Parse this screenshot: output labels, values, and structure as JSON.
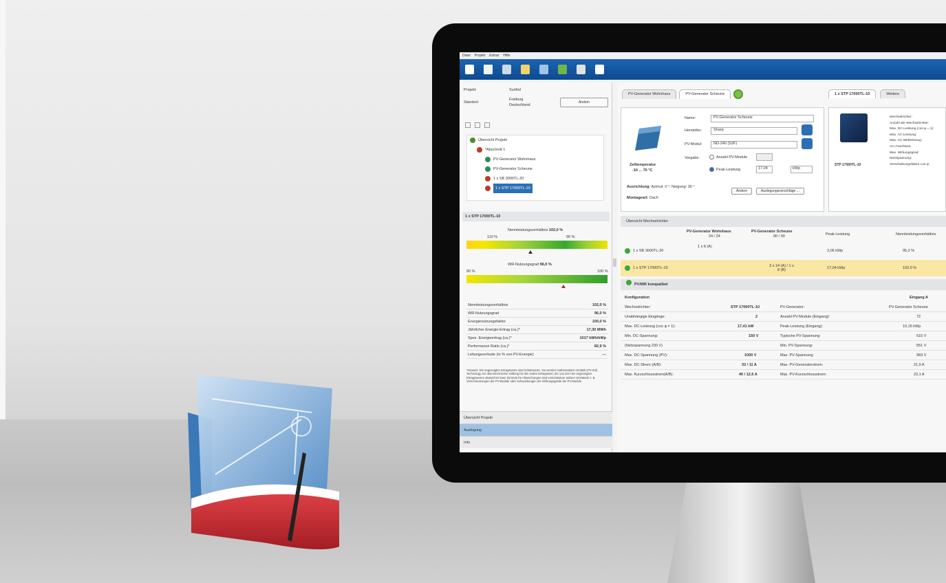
{
  "menu": [
    "Datei",
    "Projekt",
    "Extras",
    "Hilfe"
  ],
  "toolbar_icons": [
    "new-file-icon",
    "open-folder-icon",
    "save-icon",
    "home-icon",
    "report-icon",
    "tools-icon",
    "print-icon",
    "document-icon"
  ],
  "left": {
    "project_label": "Projekt:",
    "project_value": "Sunfoil",
    "location_label": "Standort:",
    "location_value_1": "Freiburg",
    "location_value_2": "Deutschland",
    "change_button": "Ändern",
    "tree": [
      "Übersicht Projekt",
      "*Abschnitt 1",
      "PV-Generator Wohnhaus",
      "PV-Generator Scheune",
      "1 x SB 3000TL-20",
      "1 x STP 17000TL-10"
    ],
    "detail_title": "1 x STP 17000TL-10",
    "ratio_label": "Nennleistungsverhältnis",
    "ratio_value": "102,0 %",
    "ratio_min": "110 %",
    "ratio_max": "90 %",
    "util_label": "WR-Nutzungsgrad",
    "util_value": "96,0 %",
    "util_min": "90 %",
    "util_max": "100 %",
    "values": [
      {
        "k": "Nennleistungsverhältnis",
        "v": "102,0 %"
      },
      {
        "k": "WR-Nutzungsgrad",
        "v": "96,0 %"
      },
      {
        "k": "Energienutzungsfaktor",
        "v": "100,0 %"
      },
      {
        "k": "Jährlicher Energie-Ertrag (ca.)*",
        "v": "17,30 MWh"
      },
      {
        "k": "Spez. Energieertrag (ca.)*",
        "v": "1017 kWh/kWp"
      },
      {
        "k": "Performance Ratio (ca.)*",
        "v": "82,9 %"
      },
      {
        "k": "Leitungsverluste (in % von PV-Energie)",
        "v": "---"
      }
    ],
    "footnote": "*Hinweis: Die angezeigten Ertragswerte sind Schätzwerte. Sie werden mathematisch ermittelt (PV-Sol) Technology AG übernimmt keine Haftung für den realen Ertragswert, der von den hier angezeigten Ertragswerten abweichen kann (Gründe für Abweichungen sind verschiedene äußere Umstände z. B. Verschmutzungen der PV-Module oder Schwankungen der Wirkungsgrade der PV-Module.",
    "accordions": [
      "Übersicht Projekt",
      "Auslegung",
      "Info"
    ]
  },
  "right": {
    "tabs": [
      "PV-Generator Wohnhaus",
      "PV-Generator Scheune"
    ],
    "inverter_tab": "1 x STP 17000TL-10",
    "inverter_tab2": "Weitere",
    "name_label": "Name:",
    "name_value": "PV-Generator Scheune",
    "manufacturer_label": "Hersteller:",
    "manufacturer_value": "Sharp",
    "module_label": "PV-Modul:",
    "module_value": "ND-240 (S2F)",
    "input_label": "Vorgabe:",
    "count_label": "Anzahl PV-Module",
    "peak_label": "Peak-Leistung",
    "peak_value": "17,04",
    "peak_unit": "kWp",
    "cell_temp_label": "Zelltemperatur",
    "cell_temp_value": "-10 ... 70 °C",
    "orientation_label": "Ausrichtung:",
    "orientation_value": "Azimut: 0 °; Neigung: 30 °",
    "mount_label": "Montageart:",
    "mount_value": "Dach",
    "change_button": "Ändern",
    "suggest_button": "Auslegungsvorschläge ...",
    "inverter_name": "STP 17000TL-10",
    "inverter_props": [
      "Wechselrichter:",
      "Anzahl der Wechselrichter:",
      "Max. DC-Leistung (cos φ = 1):",
      "Max. AC-Leistung:",
      "Max. AC-Wirkleistung:",
      "AC-Anschluss:",
      "Max. Wirkungsgrad:",
      "Netzspannung:",
      "Verschiebungsfaktor cos φ:"
    ],
    "overview_title": "Übersicht Wechselrichter",
    "ov_cols": [
      "PV-Generator Wohnhaus",
      "PV-Generator Scheune",
      "Peak-Leistung",
      "Nennleistungsverhältnis"
    ],
    "ov_sub": [
      "24 / 24",
      "90 / 90"
    ],
    "ov_rows": [
      {
        "name": "1 x SB 3000TL-20",
        "a": "1 x 8 (A)",
        "b": "",
        "peak": "3,06 kWp",
        "ratio": "95,2 %"
      },
      {
        "name": "1 x STP 17000TL-10",
        "a": "",
        "b": "3 x 14 (A) / 1 x 8 (B)",
        "peak": "17,04 kWp",
        "ratio": "102,0 %"
      }
    ],
    "compat_label": "PV/WR kompatibel",
    "config_label": "Konfiguration",
    "input_a_label": "Eingang A",
    "config": [
      {
        "k": "Wechselrichter:",
        "v": "STP 17000TL-10",
        "k2": "PV-Generator:",
        "v2": "PV-Generator Scheune"
      },
      {
        "k": "Unabhängige Eingänge:",
        "v": "2",
        "k2": "Anzahl PV-Module (Eingang):",
        "v2": "72"
      },
      {
        "k": "Max. DC-Leistung (cos φ = 1):",
        "v": "17,41 kW",
        "k2": "Peak-Leistung (Eingang):",
        "v2": "10,15 kWp"
      },
      {
        "k": "Min. DC-Spannung:",
        "v": "150 V",
        "k2": "Typische PV-Spannung:",
        "v2": "615 V"
      },
      {
        "k": "(Netzspannung 230 V)",
        "v": "",
        "k2": "Min. PV-Spannung:",
        "v2": "551 V"
      },
      {
        "k": "Max. DC-Spannung (PV):",
        "v": "1000 V",
        "k2": "Max. PV-Spannung:",
        "v2": "983 V"
      },
      {
        "k": "Max. DC-Strom (A/B):",
        "v": "33 / 11 A",
        "k2": "Max. PV-Generatorstrom:",
        "v2": "21,9 A"
      },
      {
        "k": "Max. Kurzschlussstrom(A/B):",
        "v": "40 / 12,5 A",
        "k2": "Max. PV-Kurzschlussstrom:",
        "v2": "23,1 A"
      }
    ]
  },
  "colors": {
    "toolbar": "#1559a8",
    "accent": "#2d6fb5",
    "ok": "#3da83a",
    "highlight": "#fbe7a4"
  }
}
